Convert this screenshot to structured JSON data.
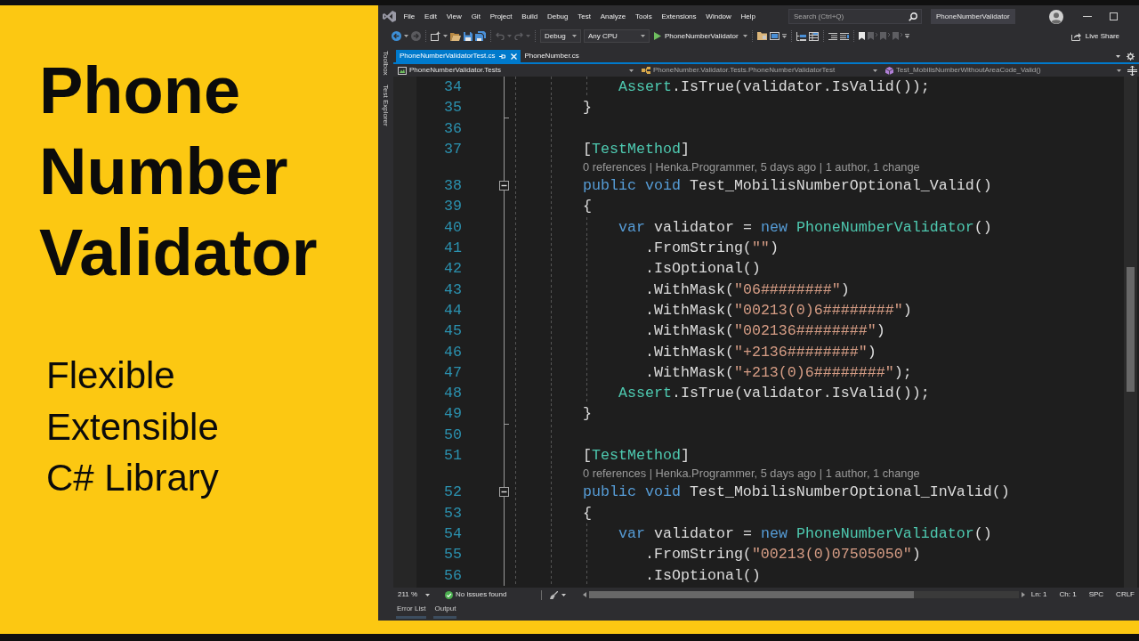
{
  "promo": {
    "title": "Phone Number Validator",
    "taglines": [
      "Flexible",
      "Extensible",
      "C# Library"
    ]
  },
  "menu_bar": {
    "items": [
      "File",
      "Edit",
      "View",
      "Git",
      "Project",
      "Build",
      "Debug",
      "Test",
      "Analyze",
      "Tools",
      "Extensions",
      "Window",
      "Help"
    ],
    "search": {
      "placeholder": "Search (Ctrl+Q)"
    },
    "solution": "PhoneNumberValidator"
  },
  "toolbar": {
    "back": {
      "disabled": false
    },
    "forward": {
      "disabled": true
    },
    "undo": {
      "disabled": true
    },
    "redo": {
      "disabled": true
    },
    "configuration": "Debug",
    "platform": "Any CPU",
    "start": "PhoneNumberValidator",
    "toggle_bookmark": {
      "disabled": false
    },
    "previous_bookmark": {
      "disabled": true
    },
    "next_bookmark": {
      "disabled": true
    },
    "clear_bookmarks": {
      "disabled": true
    },
    "live_share": "Live Share"
  },
  "side_panels": [
    "Toolbox",
    "Test Explorer"
  ],
  "tabs": [
    {
      "label": "PhoneNumberValidatorTest.cs",
      "selected": true
    },
    {
      "label": "PhoneNumber.cs",
      "selected": false
    }
  ],
  "navigation_bar": {
    "project": "PhoneNumberValidator.Tests",
    "type": "PhoneNumber.Validator.Tests.PhoneNumberValidatorTest",
    "member": "Test_MobilisNumberWithoutAreaCode_Valid()"
  },
  "editor": {
    "lines": [
      {
        "kind": "code",
        "number": "34",
        "block_end": false,
        "tokens": [
          {
            "text": "            Assert",
            "kind": "type"
          },
          {
            "text": ".IsTrue(validator.IsValid());",
            "kind": "plain"
          }
        ]
      },
      {
        "kind": "code",
        "number": "35",
        "block_end": true,
        "tokens": [
          {
            "text": "        }",
            "kind": "plain"
          }
        ]
      },
      {
        "kind": "code",
        "number": "36",
        "block_end": false
      },
      {
        "kind": "code",
        "number": "37",
        "block_end": false,
        "tokens": [
          {
            "text": "        [",
            "kind": "plain"
          },
          {
            "text": "TestMethod",
            "kind": "type"
          },
          {
            "text": "]",
            "kind": "plain"
          }
        ]
      },
      {
        "kind": "codelens",
        "text": "0 references | Henka.Programmer, 5 days ago | 1 author, 1 change"
      },
      {
        "kind": "code",
        "number": "38",
        "block_end": false,
        "fold": {
          "expanded": true
        },
        "tokens": [
          {
            "text": "        public void",
            "kind": "keyword"
          },
          {
            "text": " Test_MobilisNumberOptional_Valid()",
            "kind": "plain"
          }
        ]
      },
      {
        "kind": "code",
        "number": "39",
        "block_end": false,
        "tokens": [
          {
            "text": "        {",
            "kind": "plain"
          }
        ]
      },
      {
        "kind": "code",
        "number": "40",
        "block_end": false,
        "tokens": [
          {
            "text": "            var",
            "kind": "keyword"
          },
          {
            "text": " validator = ",
            "kind": "plain"
          },
          {
            "text": "new",
            "kind": "keyword"
          },
          {
            "text": " PhoneNumberValidator",
            "kind": "type"
          },
          {
            "text": "()",
            "kind": "plain"
          }
        ]
      },
      {
        "kind": "code",
        "number": "41",
        "block_end": false,
        "tokens": [
          {
            "text": "               .FromString(",
            "kind": "plain"
          },
          {
            "text": "\"\"",
            "kind": "string"
          },
          {
            "text": ")",
            "kind": "plain"
          }
        ]
      },
      {
        "kind": "code",
        "number": "42",
        "block_end": false,
        "tokens": [
          {
            "text": "               .IsOptional()",
            "kind": "plain"
          }
        ]
      },
      {
        "kind": "code",
        "number": "43",
        "block_end": false,
        "tokens": [
          {
            "text": "               .WithMask(",
            "kind": "plain"
          },
          {
            "text": "\"06########\"",
            "kind": "string"
          },
          {
            "text": ")",
            "kind": "plain"
          }
        ]
      },
      {
        "kind": "code",
        "number": "44",
        "block_end": false,
        "tokens": [
          {
            "text": "               .WithMask(",
            "kind": "plain"
          },
          {
            "text": "\"00213(0)6########\"",
            "kind": "string"
          },
          {
            "text": ")",
            "kind": "plain"
          }
        ]
      },
      {
        "kind": "code",
        "number": "45",
        "block_end": false,
        "tokens": [
          {
            "text": "               .WithMask(",
            "kind": "plain"
          },
          {
            "text": "\"002136########\"",
            "kind": "string"
          },
          {
            "text": ")",
            "kind": "plain"
          }
        ]
      },
      {
        "kind": "code",
        "number": "46",
        "block_end": false,
        "tokens": [
          {
            "text": "               .WithMask(",
            "kind": "plain"
          },
          {
            "text": "\"+2136########\"",
            "kind": "string"
          },
          {
            "text": ")",
            "kind": "plain"
          }
        ]
      },
      {
        "kind": "code",
        "number": "47",
        "block_end": false,
        "tokens": [
          {
            "text": "               .WithMask(",
            "kind": "plain"
          },
          {
            "text": "\"+213(0)6########\"",
            "kind": "string"
          },
          {
            "text": ");",
            "kind": "plain"
          }
        ]
      },
      {
        "kind": "code",
        "number": "48",
        "block_end": false,
        "tokens": [
          {
            "text": "            Assert",
            "kind": "type"
          },
          {
            "text": ".IsTrue(validator.IsValid());",
            "kind": "plain"
          }
        ]
      },
      {
        "kind": "code",
        "number": "49",
        "block_end": true,
        "tokens": [
          {
            "text": "        }",
            "kind": "plain"
          }
        ]
      },
      {
        "kind": "code",
        "number": "50",
        "block_end": false
      },
      {
        "kind": "code",
        "number": "51",
        "block_end": false,
        "tokens": [
          {
            "text": "        [",
            "kind": "plain"
          },
          {
            "text": "TestMethod",
            "kind": "type"
          },
          {
            "text": "]",
            "kind": "plain"
          }
        ]
      },
      {
        "kind": "codelens",
        "text": "0 references | Henka.Programmer, 5 days ago | 1 author, 1 change"
      },
      {
        "kind": "code",
        "number": "52",
        "block_end": false,
        "fold": {
          "expanded": true
        },
        "tokens": [
          {
            "text": "        public void",
            "kind": "keyword"
          },
          {
            "text": " Test_MobilisNumberOptional_InValid()",
            "kind": "plain"
          }
        ]
      },
      {
        "kind": "code",
        "number": "53",
        "block_end": false,
        "tokens": [
          {
            "text": "        {",
            "kind": "plain"
          }
        ]
      },
      {
        "kind": "code",
        "number": "54",
        "block_end": false,
        "tokens": [
          {
            "text": "            var",
            "kind": "keyword"
          },
          {
            "text": " validator = ",
            "kind": "plain"
          },
          {
            "text": "new",
            "kind": "keyword"
          },
          {
            "text": " PhoneNumberValidator",
            "kind": "type"
          },
          {
            "text": "()",
            "kind": "plain"
          }
        ]
      },
      {
        "kind": "code",
        "number": "55",
        "block_end": false,
        "tokens": [
          {
            "text": "               .FromString(",
            "kind": "plain"
          },
          {
            "text": "\"00213(0)07505050\"",
            "kind": "string"
          },
          {
            "text": ")",
            "kind": "plain"
          }
        ]
      },
      {
        "kind": "code",
        "number": "56",
        "block_end": false,
        "tokens": [
          {
            "text": "               .IsOptional()",
            "kind": "plain"
          }
        ]
      }
    ]
  },
  "status_bar": {
    "zoom": "211 %",
    "issues": "No issues found",
    "line": "Ln: 1",
    "column": "Ch: 1",
    "indentation": "SPC",
    "line_endings": "CRLF"
  },
  "tool_tabs": [
    "Error List",
    "Output"
  ]
}
